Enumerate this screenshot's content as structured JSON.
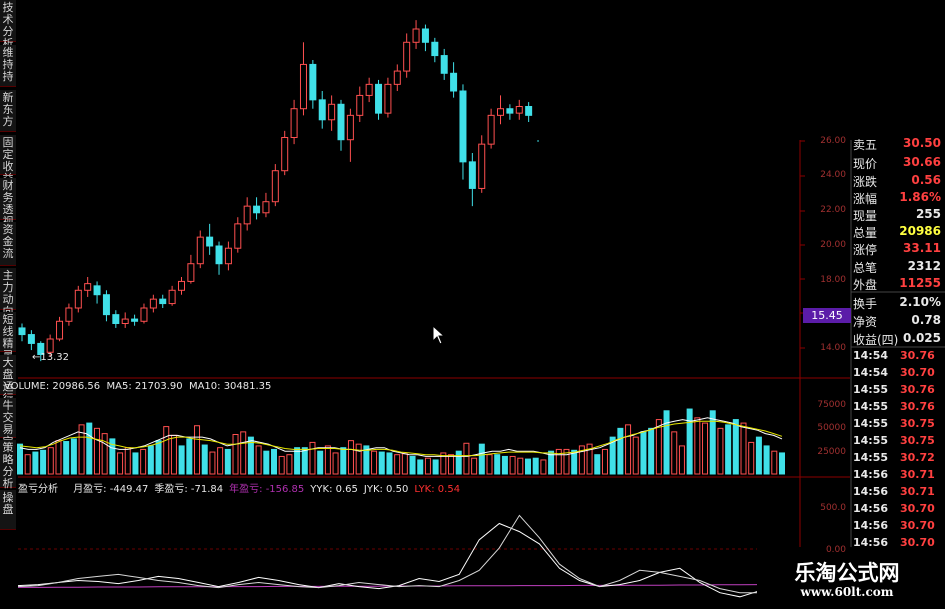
{
  "left_tabs": [
    "技术分析",
    "维持持",
    "新东方",
    "固定收益",
    "财务透视",
    "资金流",
    "主力动向",
    "短线精灵",
    "大盘运行",
    "牛交易宝",
    "策略分析",
    "操盘"
  ],
  "price_axis": [
    "24.00",
    "22.00",
    "20.00",
    "18.00",
    "14.00"
  ],
  "price_axis_partial_top": "26.00",
  "low_marker": "13.32",
  "crosshair_price": "15.45",
  "volume_header": {
    "label": "VOLUME: 20986.56",
    "ma5": "MA5: 21703.90",
    "ma10": "MA10: 30481.35"
  },
  "volume_axis": [
    "75000",
    "50000",
    "25000"
  ],
  "indicator_header": {
    "name": "盈亏分析",
    "items": [
      {
        "text": "月盈亏: -449.47",
        "color": "#e8e8e8"
      },
      {
        "text": "季盈亏: -71.84",
        "color": "#e8e8e8"
      },
      {
        "text": "年盈亏: -156.85",
        "color": "#b030b0"
      },
      {
        "text": "YYK: 0.65",
        "color": "#e8e8e8"
      },
      {
        "text": "JYK: 0.50",
        "color": "#e8e8e8"
      },
      {
        "text": "LYK: 0.54",
        "color": "#ff3030"
      }
    ]
  },
  "indicator_axis": [
    "500.0",
    "0.00"
  ],
  "quote_panel": {
    "top_partial": {
      "label": "卖五",
      "value": "30.50"
    },
    "rows": [
      {
        "label": "现价",
        "value": "30.66",
        "color": "#ff4040"
      },
      {
        "label": "涨跌",
        "value": "0.56",
        "color": "#ff4040"
      },
      {
        "label": "涨幅",
        "value": "1.86%",
        "color": "#ff4040"
      },
      {
        "label": "现量",
        "value": "255",
        "color": "#e8e8e8"
      },
      {
        "label": "总量",
        "value": "20986",
        "color": "#ffff40"
      },
      {
        "label": "涨停",
        "value": "33.11",
        "color": "#ff4040"
      },
      {
        "label": "总笔",
        "value": "2312",
        "color": "#e8e8e8"
      },
      {
        "label": "外盘",
        "value": "11255",
        "color": "#ff4040"
      },
      {
        "label": "换手",
        "value": "2.10%",
        "color": "#e8e8e8"
      },
      {
        "label": "净资",
        "value": "0.78",
        "color": "#e8e8e8"
      },
      {
        "label": "收益(四)",
        "value": "0.025",
        "color": "#e8e8e8"
      }
    ]
  },
  "ticks": [
    {
      "time": "14:54",
      "price": "30.76"
    },
    {
      "time": "14:54",
      "price": "30.70"
    },
    {
      "time": "14:55",
      "price": "30.76"
    },
    {
      "time": "14:55",
      "price": "30.76"
    },
    {
      "time": "14:55",
      "price": "30.75"
    },
    {
      "time": "14:55",
      "price": "30.75"
    },
    {
      "time": "14:55",
      "price": "30.72"
    },
    {
      "time": "14:56",
      "price": "30.71"
    },
    {
      "time": "14:56",
      "price": "30.71"
    },
    {
      "time": "14:56",
      "price": "30.70"
    },
    {
      "time": "14:56",
      "price": "30.70"
    },
    {
      "time": "14:56",
      "price": "30.70"
    }
  ],
  "watermark": {
    "title": "乐淘公式网",
    "url": "www.60lt.com"
  },
  "colors": {
    "up": "#ff5050",
    "down": "#40e0e8",
    "grid": "#8b0000",
    "bg": "#000000"
  },
  "chart_data": {
    "type": "candlestick",
    "price_range": [
      13,
      27
    ],
    "candles": [
      [
        14.9,
        14.6,
        15.1,
        14.3
      ],
      [
        14.6,
        14.2,
        14.8,
        13.9
      ],
      [
        14.2,
        13.7,
        14.3,
        13.4
      ],
      [
        13.8,
        14.4,
        14.6,
        13.6
      ],
      [
        14.4,
        15.2,
        15.4,
        14.3
      ],
      [
        15.2,
        15.8,
        16.0,
        15.0
      ],
      [
        15.8,
        16.6,
        16.8,
        15.6
      ],
      [
        16.6,
        16.9,
        17.2,
        16.3
      ],
      [
        16.8,
        16.4,
        17.0,
        16.0
      ],
      [
        16.4,
        15.5,
        16.6,
        15.2
      ],
      [
        15.5,
        15.1,
        15.7,
        14.9
      ],
      [
        15.1,
        15.3,
        15.6,
        14.9
      ],
      [
        15.3,
        15.2,
        15.5,
        15.0
      ],
      [
        15.2,
        15.8,
        16.0,
        15.1
      ],
      [
        15.8,
        16.2,
        16.4,
        15.6
      ],
      [
        16.2,
        16.0,
        16.4,
        15.8
      ],
      [
        16.0,
        16.6,
        16.8,
        15.9
      ],
      [
        16.6,
        17.0,
        17.2,
        16.4
      ],
      [
        17.0,
        17.8,
        18.2,
        16.9
      ],
      [
        17.8,
        19.0,
        19.3,
        17.6
      ],
      [
        19.0,
        18.6,
        19.6,
        18.2
      ],
      [
        18.6,
        17.8,
        18.8,
        17.3
      ],
      [
        17.8,
        18.5,
        18.8,
        17.5
      ],
      [
        18.5,
        19.6,
        19.9,
        18.3
      ],
      [
        19.6,
        20.4,
        20.8,
        19.3
      ],
      [
        20.4,
        20.1,
        20.8,
        19.8
      ],
      [
        20.1,
        20.6,
        21.0,
        19.9
      ],
      [
        20.6,
        22.0,
        22.3,
        20.4
      ],
      [
        22.0,
        23.5,
        23.8,
        21.8
      ],
      [
        23.5,
        24.8,
        25.2,
        23.2
      ],
      [
        24.8,
        26.8,
        27.8,
        24.5
      ],
      [
        26.8,
        25.2,
        27.0,
        24.8
      ],
      [
        25.2,
        24.3,
        25.6,
        23.9
      ],
      [
        24.3,
        25.0,
        25.4,
        23.8
      ],
      [
        25.0,
        23.4,
        25.2,
        22.9
      ],
      [
        23.4,
        24.5,
        24.8,
        22.4
      ],
      [
        24.5,
        25.4,
        25.8,
        24.2
      ],
      [
        25.4,
        25.9,
        26.2,
        25.1
      ],
      [
        25.9,
        24.6,
        26.1,
        24.3
      ],
      [
        24.6,
        25.9,
        26.2,
        24.4
      ],
      [
        25.9,
        26.5,
        26.8,
        25.6
      ],
      [
        26.5,
        27.8,
        28.2,
        26.2
      ],
      [
        27.8,
        28.4,
        28.8,
        27.5
      ],
      [
        28.4,
        27.8,
        28.6,
        27.4
      ],
      [
        27.8,
        27.2,
        28.0,
        26.9
      ],
      [
        27.2,
        26.4,
        27.5,
        26.1
      ],
      [
        26.4,
        25.6,
        26.9,
        25.3
      ],
      [
        25.6,
        22.4,
        25.9,
        21.6
      ],
      [
        22.4,
        21.2,
        22.8,
        20.4
      ],
      [
        21.2,
        23.2,
        23.6,
        21.0
      ],
      [
        23.2,
        24.5,
        24.8,
        23.0
      ],
      [
        24.5,
        24.8,
        25.4,
        24.1
      ],
      [
        24.8,
        24.6,
        25.0,
        24.3
      ],
      [
        24.6,
        24.9,
        25.2,
        24.3
      ],
      [
        24.9,
        24.5,
        25.1,
        24.2
      ],
      [
        24.5,
        23.6,
        24.7,
        23.3
      ],
      [
        23.6,
        24.2,
        24.6,
        23.5
      ],
      [
        24.2,
        25.4,
        25.8,
        24.0
      ],
      [
        25.4,
        25.9,
        26.2,
        25.1
      ],
      [
        25.9,
        26.2,
        26.5,
        25.7
      ],
      [
        26.2,
        26.0,
        26.6,
        25.8
      ],
      [
        26.0,
        26.2,
        26.4,
        25.8
      ],
      [
        26.2,
        26.1,
        26.4,
        25.9
      ],
      [
        26.1,
        26.1,
        26.3,
        25.8
      ],
      [
        26.1,
        25.9,
        26.3,
        25.6
      ],
      [
        25.9,
        25.4,
        26.0,
        25.1
      ],
      [
        25.4,
        25.2,
        25.6,
        25.0
      ],
      [
        25.2,
        25.8,
        26.0,
        25.1
      ],
      [
        25.8,
        26.4,
        26.6,
        25.7
      ]
    ],
    "extra_candle": [
      26.3,
      25.2,
      26.5,
      25.0
    ],
    "volume": [
      34,
      22,
      25,
      27,
      30,
      38,
      37,
      40,
      56,
      58,
      52,
      46,
      40,
      24,
      30,
      24,
      28,
      32,
      38,
      54,
      44,
      32,
      40,
      55,
      33,
      25,
      30,
      28,
      45,
      48,
      42,
      32,
      26,
      28,
      20,
      22,
      30,
      30,
      36,
      26,
      32,
      24,
      30,
      38,
      34,
      32,
      26,
      25,
      24,
      22,
      23,
      20,
      16,
      18,
      16,
      24,
      22,
      26,
      35,
      18,
      34,
      22,
      22,
      20,
      20,
      18,
      17,
      18,
      16,
      26,
      28,
      28,
      27,
      32,
      34,
      22,
      28,
      42,
      52,
      56,
      42,
      48,
      52,
      62,
      72,
      48,
      32,
      74,
      64,
      58,
      72,
      52,
      56,
      62,
      58,
      36,
      42,
      32,
      26,
      24
    ],
    "volume_range": [
      0,
      90000
    ],
    "ma_volume_lines": {
      "ma5": [
        30,
        28,
        28,
        30,
        36,
        40,
        44,
        48,
        46,
        40,
        36,
        30,
        28,
        28,
        30,
        32,
        36,
        40,
        44,
        44,
        42,
        42,
        42,
        40,
        36,
        32,
        34,
        36,
        38,
        36,
        34,
        30,
        26,
        26,
        26,
        28,
        30,
        30,
        30,
        28,
        28,
        26,
        28,
        30,
        30,
        26,
        24,
        22,
        22,
        20,
        20,
        20,
        20,
        20,
        20,
        22,
        24,
        26,
        26,
        28,
        26,
        26,
        26,
        24,
        22,
        22,
        22,
        24,
        26,
        28,
        30,
        34,
        38,
        42,
        44,
        48,
        50,
        54,
        58,
        60,
        62,
        60,
        62,
        64,
        62,
        60,
        58,
        54,
        52,
        50,
        46,
        44,
        40
      ],
      "ma10": [
        32,
        31,
        30,
        31,
        34,
        38,
        41,
        42,
        42,
        40,
        38,
        34,
        32,
        30,
        30,
        31,
        33,
        36,
        40,
        42,
        42,
        40,
        39,
        38,
        36,
        34,
        34,
        35,
        36,
        35,
        33,
        31,
        29,
        28,
        28,
        28,
        29,
        29,
        29,
        28,
        28,
        27,
        27,
        28,
        28,
        27,
        25,
        24,
        23,
        22,
        22,
        21,
        21,
        21,
        21,
        21,
        22,
        23,
        24,
        25,
        25,
        25,
        25,
        24,
        24,
        23,
        24,
        25,
        27,
        29,
        32,
        35,
        39,
        42,
        45,
        47,
        50,
        53,
        55,
        57,
        58,
        59,
        60,
        60,
        60,
        59,
        57,
        55,
        53,
        51,
        49,
        46,
        43
      ]
    },
    "indicator_lines": {
      "purple": [
        0.06,
        0.06,
        0.07,
        0.07,
        0.08,
        0.08,
        0.08,
        0.09,
        0.09,
        0.09,
        0.1,
        0.1,
        0.1,
        0.11,
        0.11,
        0.11,
        0.12,
        0.12,
        0.12,
        0.13,
        0.13,
        0.13,
        0.14,
        0.14,
        0.14,
        0.15,
        0.15,
        0.15,
        0.16,
        0.16,
        0.16,
        0.17,
        0.17,
        0.18,
        0.18,
        0.19,
        0.19,
        0.2
      ],
      "white1": [
        0.15,
        0.2,
        0.3,
        0.4,
        0.35,
        0.25,
        0.4,
        0.6,
        0.5,
        0.3,
        0.1,
        0.3,
        0.55,
        0.4,
        0.2,
        0.05,
        0.25,
        0.1,
        0.0,
        0.15,
        0.5,
        0.35,
        0.7,
        2.4,
        3.2,
        2.8,
        2.2,
        1.0,
        0.4,
        0.1,
        0.2,
        0.4,
        0.8,
        1.0,
        0.3,
        -0.2,
        -0.4,
        -0.1
      ],
      "white2": [
        0.1,
        0.15,
        0.3,
        0.5,
        0.6,
        0.7,
        0.55,
        0.4,
        0.3,
        0.15,
        0.05,
        0.2,
        0.3,
        0.2,
        0.1,
        0.05,
        0.15,
        0.3,
        0.2,
        0.1,
        0.15,
        0.1,
        0.4,
        0.9,
        2.0,
        3.6,
        2.5,
        1.2,
        0.5,
        0.1,
        0.4,
        0.9,
        0.8,
        0.6,
        0.4,
        0.0,
        -0.2,
        -0.2
      ]
    },
    "indicator_range": [
      -1,
      4.6
    ]
  }
}
